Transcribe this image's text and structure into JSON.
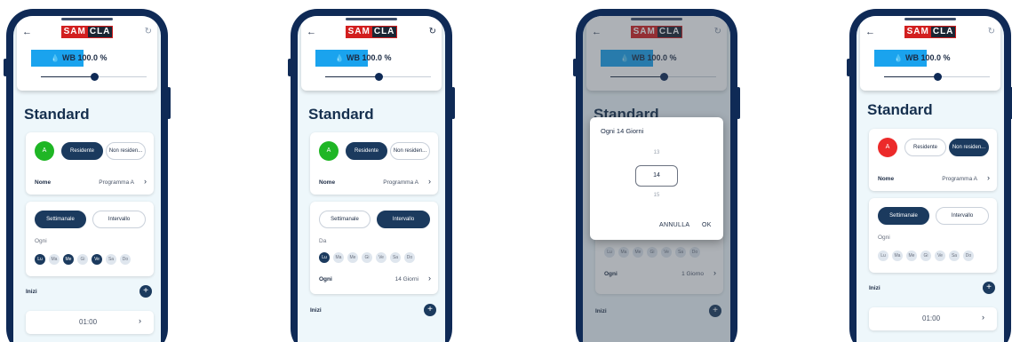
{
  "logo": {
    "red_part": "SAM",
    "white_part": "CLA"
  },
  "wb_label": "WB 100.0 %",
  "wb_fill": 0.5,
  "page_title": "Standard",
  "screens": [
    {
      "avatar": "A",
      "avatar_color": "#1fb625",
      "resident": "Residente",
      "non_resident": "Non residen...",
      "resident_selected": true,
      "name_label": "Nome",
      "name_value": "Programma A",
      "weekly": "Settimanale",
      "interval": "Intervallo",
      "weekly_selected": true,
      "ogni_label": "Ogni",
      "days": [
        "Lu",
        "Ma",
        "Me",
        "Gi",
        "Ve",
        "Sa",
        "Do"
      ],
      "days_on": [
        true,
        false,
        true,
        false,
        true,
        false,
        false
      ],
      "start_label": "Inizi",
      "time": "01:00"
    },
    {
      "avatar": "A",
      "avatar_color": "#1fb625",
      "resident": "Residente",
      "non_resident": "Non residen...",
      "resident_selected": true,
      "name_label": "Nome",
      "name_value": "Programma A",
      "weekly": "Settimanale",
      "interval": "Intervallo",
      "weekly_selected": false,
      "da_label": "Da",
      "days": [
        "Lu",
        "Ma",
        "Me",
        "Gi",
        "Ve",
        "Sa",
        "Do"
      ],
      "days_on": [
        true,
        false,
        false,
        false,
        false,
        false,
        false
      ],
      "ogni_label": "Ogni",
      "ogni_value": "14 Giorni",
      "start_label": "Inizi"
    },
    {
      "days": [
        "Lu",
        "Ma",
        "Me",
        "Gi",
        "Ve",
        "Sa",
        "Do"
      ],
      "ogni_label": "Ogni",
      "ogni_value": "1 Giorno",
      "start_label": "Inizi",
      "dialog": {
        "title": "Ogni 14 Giorni",
        "above": "13",
        "selected": "14",
        "below": "15",
        "cancel": "ANNULLA",
        "ok": "OK"
      }
    },
    {
      "avatar": "A",
      "avatar_color": "#ec2a2a",
      "resident": "Residente",
      "non_resident": "Non residen...",
      "resident_selected": false,
      "name_label": "Nome",
      "name_value": "Programma A",
      "weekly": "Settimanale",
      "interval": "Intervallo",
      "weekly_selected": true,
      "ogni_label": "Ogni",
      "days": [
        "Lu",
        "Ma",
        "Me",
        "Gi",
        "Ve",
        "Sa",
        "Do"
      ],
      "days_on": [
        false,
        false,
        false,
        false,
        false,
        false,
        false
      ],
      "start_label": "Inizi",
      "time": "01:00"
    }
  ]
}
